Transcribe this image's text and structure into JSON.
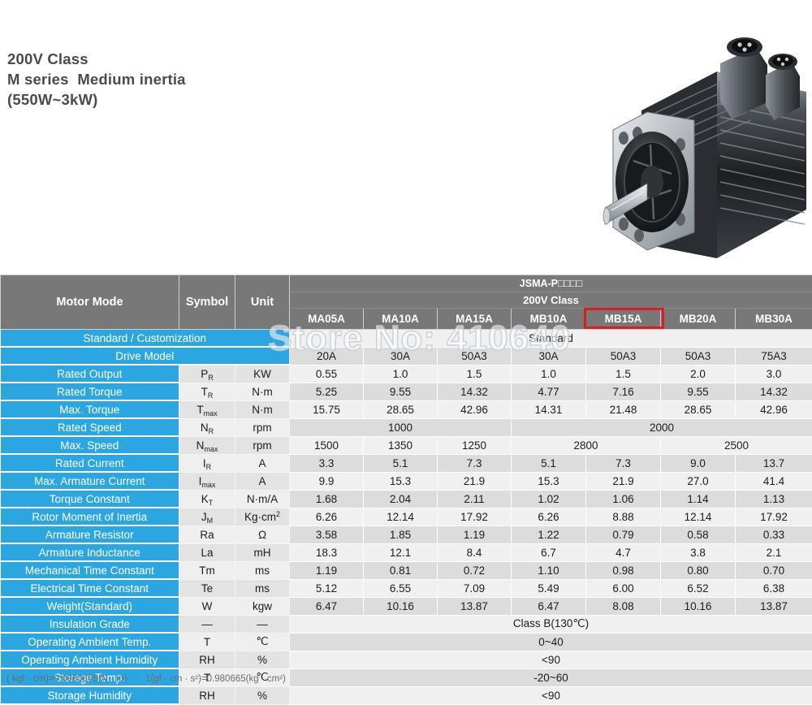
{
  "banner": {
    "title_lines": [
      "200V Class",
      "M series  Medium inertia",
      "(550W~3kW)"
    ],
    "product_image_name": "ac-servo-motor-photo"
  },
  "watermark": {
    "text": "Store No: 410640"
  },
  "table": {
    "header": {
      "motor_mode": "Motor Mode",
      "symbol": "Symbol",
      "unit": "Unit",
      "series_code": "JSMA-P□□□□",
      "voltage_class": "200V Class",
      "models": [
        "MA05A",
        "MA10A",
        "MA15A",
        "MB10A",
        "MB15A",
        "MB20A",
        "MB30A"
      ],
      "highlighted_model": "MB15A",
      "highlight_color": "#e01b1b"
    },
    "section_rows": [
      {
        "label": "Standard / Customization",
        "value": "Standard"
      },
      {
        "label": "Drive Model",
        "values": [
          "20A",
          "30A",
          "50A3",
          "30A",
          "50A3",
          "50A3",
          "75A3"
        ]
      }
    ],
    "rows": [
      {
        "label": "Rated Output",
        "symbol": "PR",
        "sym_main": "P",
        "sym_sub": "R",
        "unit": "KW",
        "values": [
          "0.55",
          "1.0",
          "1.5",
          "1.0",
          "1.5",
          "2.0",
          "3.0"
        ]
      },
      {
        "label": "Rated Torque",
        "symbol": "TR",
        "sym_main": "T",
        "sym_sub": "R",
        "unit": "N·m",
        "values": [
          "5.25",
          "9.55",
          "14.32",
          "4.77",
          "7.16",
          "9.55",
          "14.32"
        ]
      },
      {
        "label": "Max. Torque",
        "symbol": "Tmax",
        "sym_main": "T",
        "sym_sub": "max",
        "unit": "N·m",
        "values": [
          "15.75",
          "28.65",
          "42.96",
          "14.31",
          "21.48",
          "28.65",
          "42.96"
        ]
      },
      {
        "label": "Rated Speed",
        "symbol": "NR",
        "sym_main": "N",
        "sym_sub": "R",
        "unit": "rpm",
        "merged": [
          {
            "text": "1000",
            "span": 3
          },
          {
            "text": "2000",
            "span": 4
          }
        ]
      },
      {
        "label": "Max. Speed",
        "symbol": "Nmax",
        "sym_main": "N",
        "sym_sub": "max",
        "unit": "rpm",
        "merged": [
          {
            "text": "1500",
            "span": 1
          },
          {
            "text": "1350",
            "span": 1
          },
          {
            "text": "1250",
            "span": 1
          },
          {
            "text": "2800",
            "span": 2
          },
          {
            "text": "2500",
            "span": 2
          }
        ]
      },
      {
        "label": "Rated Current",
        "symbol": "IR",
        "sym_main": "I",
        "sym_sub": "R",
        "unit": "A",
        "values": [
          "3.3",
          "5.1",
          "7.3",
          "5.1",
          "7.3",
          "9.0",
          "13.7"
        ]
      },
      {
        "label": "Max. Armature Current",
        "symbol": "Imax",
        "sym_main": "I",
        "sym_sub": "max",
        "unit": "A",
        "values": [
          "9.9",
          "15.3",
          "21.9",
          "15.3",
          "21.9",
          "27.0",
          "41.4"
        ]
      },
      {
        "label": "Torque Constant",
        "symbol": "KT",
        "sym_main": "K",
        "sym_sub": "T",
        "unit": "N·m/A",
        "values": [
          "1.68",
          "2.04",
          "2.11",
          "1.02",
          "1.06",
          "1.14",
          "1.13"
        ]
      },
      {
        "label": "Rotor Moment of Inertia",
        "symbol": "JM",
        "sym_main": "J",
        "sym_sub": "M",
        "unit": "Kg·cm",
        "unit_sup": "2",
        "values": [
          "6.26",
          "12.14",
          "17.92",
          "6.26",
          "8.88",
          "12.14",
          "17.92"
        ]
      },
      {
        "label": "Armature Resistor",
        "symbol": "Ra",
        "sym_main": "Ra",
        "sym_sub": "",
        "unit": "Ω",
        "values": [
          "3.58",
          "1.85",
          "1.19",
          "1.22",
          "0.79",
          "0.58",
          "0.33"
        ]
      },
      {
        "label": "Armature Inductance",
        "symbol": "La",
        "sym_main": "La",
        "sym_sub": "",
        "unit": "mH",
        "values": [
          "18.3",
          "12.1",
          "8.4",
          "6.7",
          "4.7",
          "3.8",
          "2.1"
        ]
      },
      {
        "label": "Mechanical Time Constant",
        "symbol": "Tm",
        "sym_main": "Tm",
        "sym_sub": "",
        "unit": "ms",
        "values": [
          "1.19",
          "0.81",
          "0.72",
          "1.10",
          "0.98",
          "0.80",
          "0.70"
        ]
      },
      {
        "label": "Electrical Time Constant",
        "symbol": "Te",
        "sym_main": "Te",
        "sym_sub": "",
        "unit": "ms",
        "values": [
          "5.12",
          "6.55",
          "7.09",
          "5.49",
          "6.00",
          "6.52",
          "6.38"
        ]
      },
      {
        "label": "Weight(Standard)",
        "symbol": "W",
        "sym_main": "W",
        "sym_sub": "",
        "unit": "kgw",
        "values": [
          "6.47",
          "10.16",
          "13.87",
          "6.47",
          "8.08",
          "10.16",
          "13.87"
        ]
      },
      {
        "label": "Insulation Grade",
        "symbol": "—",
        "sym_main": "—",
        "sym_sub": "",
        "unit": "—",
        "merged": [
          {
            "text": "Class B(130℃)",
            "span": 7
          }
        ]
      },
      {
        "label": "Operating Ambient Temp.",
        "symbol": "T",
        "sym_main": "T",
        "sym_sub": "",
        "unit": "℃",
        "merged": [
          {
            "text": "0~40",
            "span": 7
          }
        ]
      },
      {
        "label": "Operating Ambient Humidity",
        "symbol": "RH",
        "sym_main": "RH",
        "sym_sub": "",
        "unit": "%",
        "merged": [
          {
            "text": "<90",
            "span": 7
          }
        ]
      },
      {
        "label": "Storage Temp.",
        "symbol": "T",
        "sym_main": "T",
        "sym_sub": "",
        "unit": "℃",
        "merged": [
          {
            "text": "-20~60",
            "span": 7
          }
        ]
      },
      {
        "label": "Storage Humidity",
        "symbol": "RH",
        "sym_main": "RH",
        "sym_sub": "",
        "unit": "%",
        "merged": [
          {
            "text": "<90",
            "span": 7
          }
        ]
      }
    ]
  },
  "footnote": {
    "text": "( kgf · cm)=0.0980665(N · m)   ;   1(gf · cm · s²)=0.980665(kg · cm²)"
  },
  "colors": {
    "label_blue": "#2ca6e0",
    "header_gray": "#787878",
    "row_light": "#f0f0f0",
    "row_dark": "#dcdcdc",
    "symbol_gray": "#e3e3e3",
    "accent_red": "#e01b1b"
  }
}
